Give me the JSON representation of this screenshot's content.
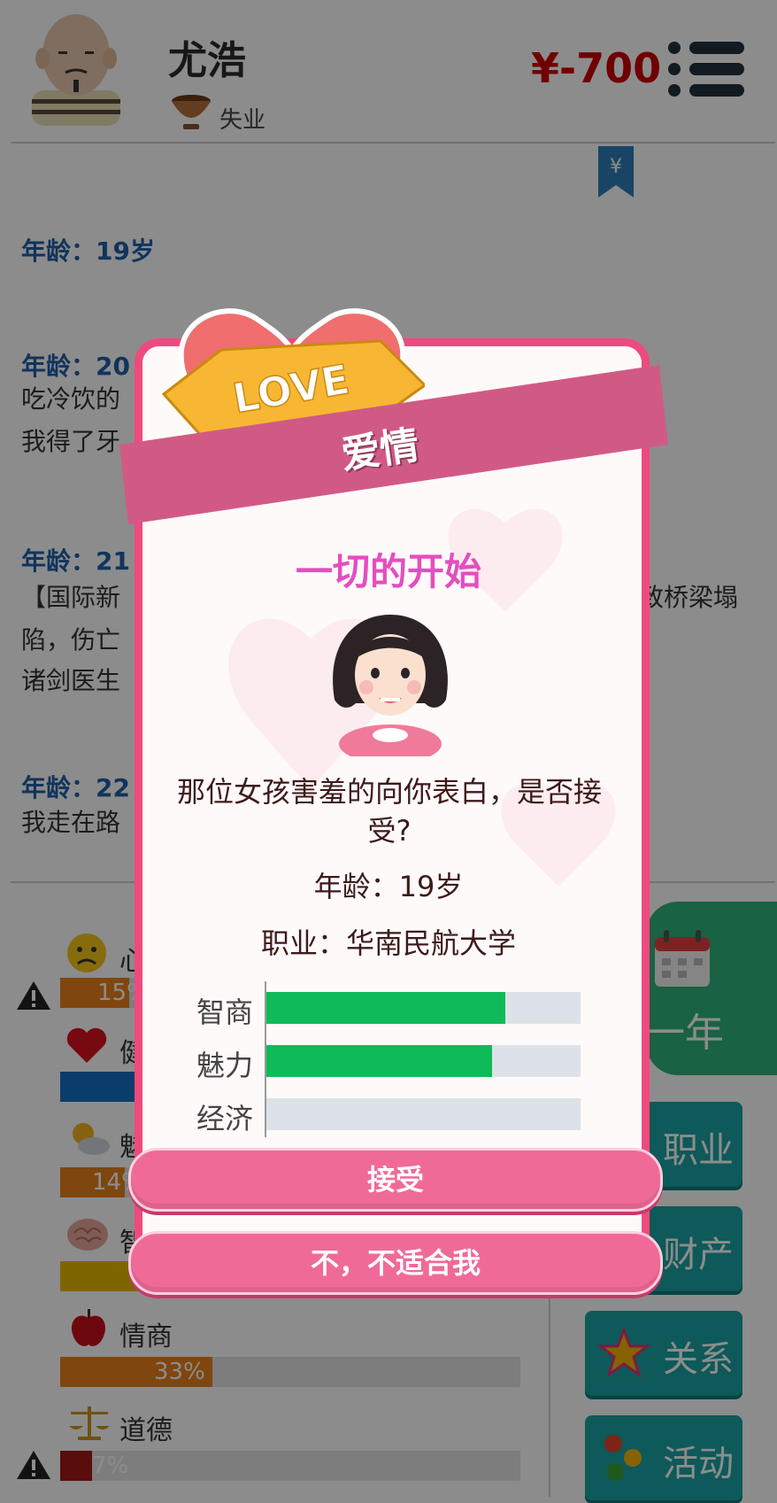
{
  "header": {
    "name": "尤浩",
    "job": "失业",
    "money": "¥-700"
  },
  "log": [
    {
      "age": "年龄：19岁",
      "lines": []
    },
    {
      "age": "年龄：20",
      "lines": [
        "吃冷饮的",
        "我得了牙"
      ]
    },
    {
      "age": "年龄：21",
      "lines": [
        "【国际新",
        "陷，伤亡",
        "诸剑医生"
      ],
      "right_fragment": "致桥梁塌"
    },
    {
      "age": "年龄：22",
      "lines": [
        "我走在路"
      ]
    }
  ],
  "stats": [
    {
      "label": "心",
      "percent": 15,
      "percent_text": "15%",
      "color": "#e8801a",
      "warn": true,
      "icon": "sad-face-icon"
    },
    {
      "label": "健",
      "percent": 100,
      "percent_text": "",
      "color": "#1570c4",
      "warn": false,
      "icon": "heart-icon"
    },
    {
      "label": "魅",
      "percent": 14,
      "percent_text": "14%",
      "color": "#e8801a",
      "warn": false,
      "icon": "sun-cloud-icon"
    },
    {
      "label": "智",
      "percent": 100,
      "percent_text": "",
      "color": "#e8b800",
      "warn": false,
      "icon": "brain-icon"
    },
    {
      "label": "情商",
      "percent": 33,
      "percent_text": "33%",
      "color": "#e8801a",
      "warn": false,
      "icon": "apple-icon"
    },
    {
      "label": "道德",
      "percent": 7,
      "percent_text": "7%",
      "color": "#a31818",
      "warn": true,
      "icon": "scales-icon"
    }
  ],
  "right_buttons": {
    "next_year": "一年",
    "career": "职业",
    "property": "财产",
    "relations": "关系",
    "activities": "活动"
  },
  "modal": {
    "banner_badge": "LOVE",
    "banner": "爱情",
    "title": "一切的开始",
    "question": "那位女孩害羞的向你表白，是否接受?",
    "age": "年龄：19岁",
    "occupation": "职业：华南民航大学",
    "attributes": [
      {
        "label": "智商",
        "value": 0.76
      },
      {
        "label": "魅力",
        "value": 0.72
      },
      {
        "label": "经济",
        "value": 0
      }
    ],
    "accept": "接受",
    "decline": "不，不适合我"
  }
}
